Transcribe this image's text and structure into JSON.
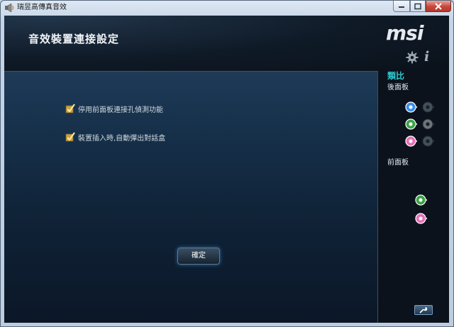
{
  "window": {
    "title": "瑞昱高傳真音效",
    "controls": {
      "minimize": "minimize-icon",
      "maximize": "maximize-icon",
      "close": "close-icon"
    }
  },
  "header": {
    "title": "音效裝置連接設定",
    "logo": "msi",
    "icons": {
      "settings": "gear-icon",
      "info": "i"
    }
  },
  "options": [
    {
      "label": "停用前面板連接孔偵測功能",
      "checked": true
    },
    {
      "label": "裝置插入時,自動彈出對話盒",
      "checked": true
    }
  ],
  "ok_button": "確定",
  "sidebar": {
    "title": "類比",
    "rear_label": "後面板",
    "front_label": "前面板",
    "rear_jacks": [
      {
        "color": "#3a8ee8",
        "active": true
      },
      {
        "color": "#4a5663",
        "active": false
      },
      {
        "color": "#3aa344",
        "active": true
      },
      {
        "color": "#7a7f85",
        "active": false
      },
      {
        "color": "#e870b8",
        "active": true
      },
      {
        "color": "#4a5663",
        "active": false
      }
    ],
    "front_jacks": [
      {
        "color": "#3aa344",
        "active": true
      },
      {
        "color": "#e870b8",
        "active": true
      }
    ],
    "wrench": "wrench-icon"
  }
}
